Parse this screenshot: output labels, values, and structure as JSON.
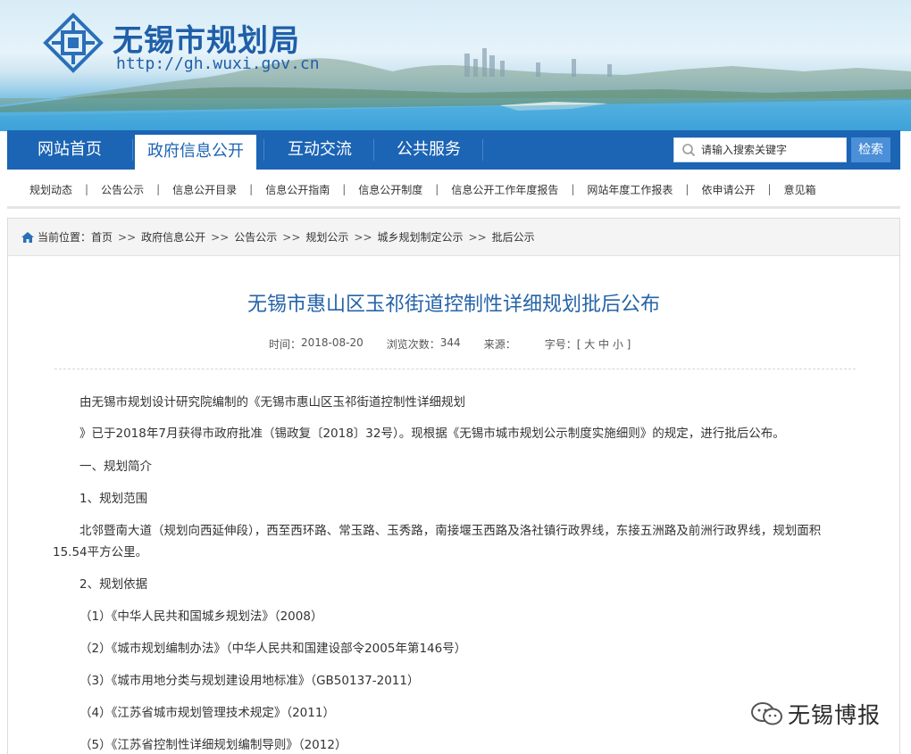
{
  "header": {
    "site_title": "无锡市规划局",
    "site_url": "http://gh.wuxi.gov.cn",
    "logo_icon": "wuxi-planning-logo-icon"
  },
  "nav": {
    "items": [
      {
        "label": "网站首页"
      },
      {
        "label": "政府信息公开"
      },
      {
        "label": "互动交流"
      },
      {
        "label": "公共服务"
      }
    ],
    "search_placeholder": "请输入搜索关键字",
    "search_button": "检索"
  },
  "subnav": {
    "items": [
      "规划动态",
      "公告公示",
      "信息公开目录",
      "信息公开指南",
      "信息公开制度",
      "信息公开工作年度报告",
      "网站年度工作报表",
      "依申请公开",
      "意见箱"
    ],
    "separator": "|"
  },
  "breadcrumb": {
    "prefix": "当前位置：",
    "items": [
      "首页",
      "政府信息公开",
      "公告公示",
      "规划公示",
      "城乡规划制定公示",
      "批后公示"
    ],
    "separator": ">>"
  },
  "article": {
    "title": "无锡市惠山区玉祁街道控制性详细规划批后公布",
    "meta": {
      "time_label": "时间：",
      "time_value": "2018-08-20",
      "views_label": "浏览次数：",
      "views_value": "344",
      "source_label": "来源：",
      "font_label": "字号：",
      "font_options": "[ 大 中 小 ]"
    },
    "paragraphs": [
      "由无锡市规划设计研究院编制的《无锡市惠山区玉祁街道控制性详细规划",
      "》已于2018年7月获得市政府批准（锡政复〔2018〕32号）。现根据《无锡市城市规划公示制度实施细则》的规定，进行批后公布。",
      "一、规划简介",
      "1、规划范围",
      "北邻暨南大道（规划向西延伸段），西至西环路、常玉路、玉秀路，南接堰玉西路及洛社镇行政界线，东接五洲路及前洲行政界线，规划面积",
      "15.54平方公里。",
      "2、规划依据",
      "（1）《中华人民共和国城乡规划法》（2008）",
      "（2）《城市规划编制办法》（中华人民共和国建设部令2005年第146号）",
      "（3）《城市用地分类与规划建设用地标准》（GB50137-2011）",
      "（4）《江苏省城市规划管理技术规定》（2011）",
      "（5）《江苏省控制性详细规划编制导则》（2012）"
    ]
  },
  "watermark": {
    "text": "无锡博报",
    "icon": "wechat-icon"
  },
  "colors": {
    "brand_blue": "#1c64b4",
    "title_blue": "#2563a8",
    "button_blue": "#4a8fd8"
  }
}
